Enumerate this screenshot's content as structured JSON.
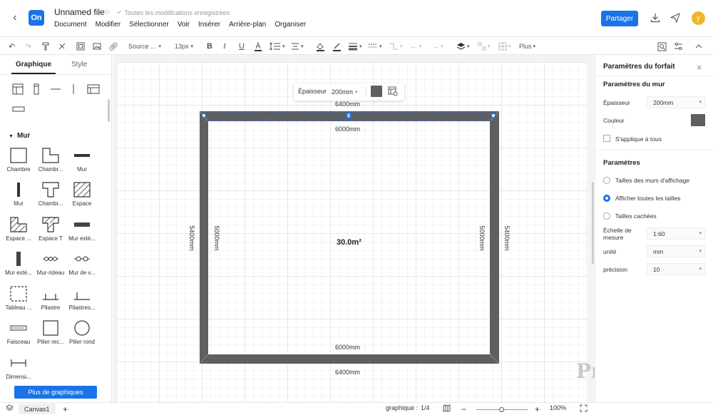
{
  "header": {
    "file_title": "Unnamed file",
    "save_status": "Toutes les modifications enregistrées",
    "logo_text": "On",
    "share_label": "Partager",
    "avatar_letter": "y",
    "menu": [
      "Document",
      "Modifier",
      "Sélectionner",
      "Voir",
      "Insérer",
      "Arrière-plan",
      "Organiser"
    ]
  },
  "toolbar": {
    "font_family": "Source ...",
    "font_size": "13px",
    "more_label": "Plus",
    "icons": [
      "undo-icon",
      "redo-icon",
      "format-painter-icon",
      "clear-format-icon",
      "screenshot-icon",
      "image-icon",
      "link-icon",
      "bold-icon",
      "italic-icon",
      "underline-icon",
      "font-color-icon",
      "line-spacing-icon",
      "align-icon",
      "fill-color-icon",
      "line-color-icon",
      "line-weight-icon",
      "line-style-icon",
      "connector-icon",
      "arrow-start-icon",
      "arrow-end-icon",
      "layer-icon",
      "position-icon",
      "table-grid-icon",
      "search-replace-icon",
      "settings-icon",
      "collapse-icon"
    ]
  },
  "left_panel": {
    "tab_graph": "Graphique",
    "tab_style": "Style",
    "section_title": "Mur",
    "more_shapes": "Plus de graphiques",
    "shapes": [
      {
        "label": "Chambre",
        "icon": "room-icon"
      },
      {
        "label": "Chambr...",
        "icon": "l-room-icon"
      },
      {
        "label": "Mur",
        "icon": "wall-icon"
      },
      {
        "label": "Mur",
        "icon": "wall-vertical-icon"
      },
      {
        "label": "Chambr...",
        "icon": "t-room-icon"
      },
      {
        "label": "Espace",
        "icon": "space-icon"
      },
      {
        "label": "Espace ...",
        "icon": "l-space-icon"
      },
      {
        "label": "Espace T",
        "icon": "t-space-icon"
      },
      {
        "label": "Mur exté...",
        "icon": "exterior-wall-icon"
      },
      {
        "label": "Mur exté...",
        "icon": "exterior-wall-vertical-icon"
      },
      {
        "label": "Mur-rideau",
        "icon": "curtain-wall-icon"
      },
      {
        "label": "Mur de v...",
        "icon": "glass-wall-icon"
      },
      {
        "label": "Tableau ...",
        "icon": "dashed-board-icon"
      },
      {
        "label": "Pilastre",
        "icon": "pilaster-icon"
      },
      {
        "label": "Pilastres...",
        "icon": "pilasters-icon"
      },
      {
        "label": "Faisceau",
        "icon": "beam-icon"
      },
      {
        "label": "Pilier rec...",
        "icon": "rect-pillar-icon"
      },
      {
        "label": "Pilier rond",
        "icon": "round-pillar-icon"
      },
      {
        "label": "Dimensi...",
        "icon": "dimension-icon"
      }
    ]
  },
  "canvas": {
    "float_label": "Épaisseur",
    "float_value": "200mm",
    "dim_top_outer": "6400mm",
    "dim_top_inner": "6000mm",
    "dim_bottom_inner": "6000mm",
    "dim_bottom_outer": "6400mm",
    "dim_left_outer": "5400mm",
    "dim_left_inner": "5000mm",
    "dim_right_inner": "5000mm",
    "dim_right_outer": "5400mm",
    "area": "30.0m²",
    "watermark": "ProcessOn"
  },
  "right_panel": {
    "title": "Paramètres du forfait",
    "wall_section": "Paramètres du mur",
    "thickness_label": "Épaisseur",
    "thickness_value": "200mm",
    "color_label": "Couleur",
    "color_value": "#5f5f5f",
    "apply_all_label": "S'applique à tous",
    "params_section": "Paramètres",
    "radio_options": [
      "Tailles des murs d'affichage",
      "Afficher toutes les tailles",
      "Tailles cachées"
    ],
    "radio_selected": 1,
    "scale_label": "Échelle de mesure",
    "scale_value": "1:60",
    "unit_label": "unité",
    "unit_value": "mm",
    "precision_label": "précision",
    "precision_value": "10"
  },
  "bottombar": {
    "page_tab": "Canvas1",
    "shape_count_label": "graphique :",
    "shape_count": "1/4",
    "zoom": "100%",
    "zoom_fraction": 0.5
  },
  "colors": {
    "accent": "#1a73e8",
    "wall": "#5f5f5f"
  }
}
